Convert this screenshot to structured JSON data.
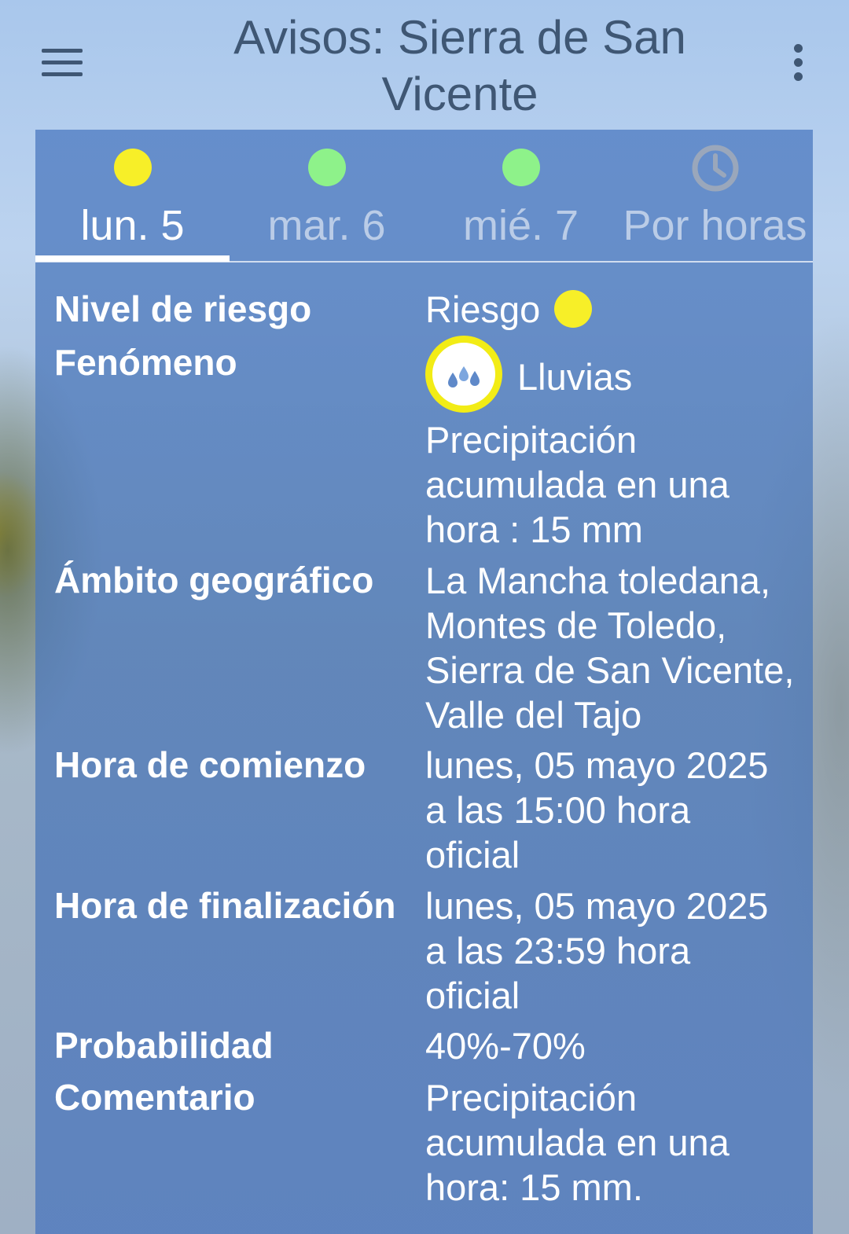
{
  "header": {
    "title": "Avisos: Sierra de San Vicente",
    "menu_icon": "hamburger-menu-icon",
    "more_icon": "more-vert-icon"
  },
  "tabs": [
    {
      "label": "lun. 5",
      "status": "yellow",
      "active": true
    },
    {
      "label": "mar. 6",
      "status": "green",
      "active": false
    },
    {
      "label": "mié. 7",
      "status": "green",
      "active": false
    },
    {
      "label": "Por horas",
      "icon": "clock-icon",
      "active": false
    }
  ],
  "colors": {
    "yellow": "#f7ef28",
    "green": "#8ef28a",
    "header_text": "#3f5774",
    "panel": "#5480c4"
  },
  "details": {
    "risk": {
      "label": "Nivel de riesgo",
      "value": "Riesgo"
    },
    "phenomenon": {
      "label": "Fenómeno",
      "name": "Lluvias",
      "icon": "rain-drops-icon",
      "description": "Precipitación acumulada en una hora : 15 mm"
    },
    "area": {
      "label": "Ámbito geográfico",
      "value": "La Mancha toledana, Montes de Toledo, Sierra de San Vicente, Valle del Tajo"
    },
    "start": {
      "label": "Hora de comienzo",
      "value": "lunes, 05 mayo 2025 a las 15:00 hora oficial"
    },
    "end": {
      "label": "Hora de finalización",
      "value": "lunes, 05 mayo 2025 a las 23:59 hora oficial"
    },
    "probability": {
      "label": "Probabilidad",
      "value": "40%-70%"
    },
    "comment": {
      "label": "Comentario",
      "value": "Precipitación acumulada en una hora: 15 mm."
    }
  }
}
